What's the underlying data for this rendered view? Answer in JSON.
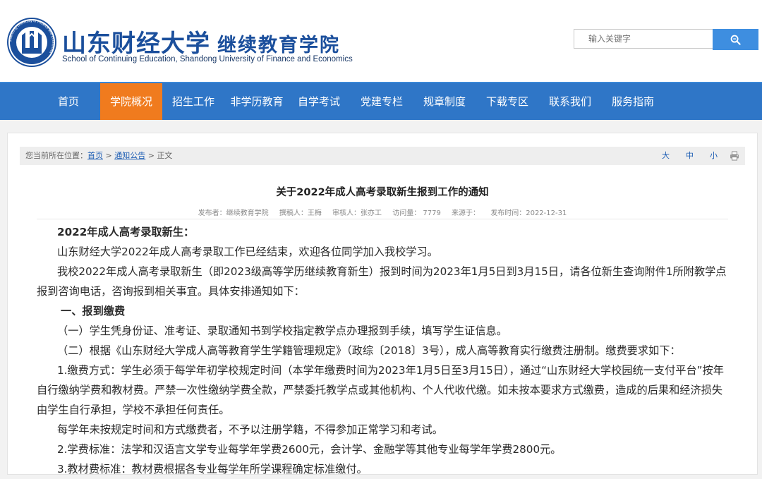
{
  "header": {
    "title_cn": "山东财经大学",
    "title_cn_sub": "继续教育学院",
    "title_en": "School of Continuing Education, Shandong University of Finance and Economics",
    "logo_ring_text": "Shandong University of Finance and Economics",
    "search_placeholder": "输入关键字",
    "search_icon": "search-icon"
  },
  "nav": {
    "items": [
      "首页",
      "学院概况",
      "招生工作",
      "非学历教育",
      "自学考试",
      "党建专栏",
      "规章制度",
      "下载专区",
      "联系我们",
      "服务指南"
    ],
    "active": "学院概况"
  },
  "breadcrumb": {
    "prefix": "您当前所在位置：",
    "home": "首页",
    "sep": " > ",
    "section": "通知公告",
    "current": "正文",
    "font_large": "大",
    "font_medium": "中",
    "font_small": "小",
    "print_icon": "printer-icon"
  },
  "article": {
    "title": "关于2022年成人高考录取新生报到工作的通知",
    "meta": {
      "publisher": "发布者：继续教育学院",
      "author": "撰稿人：王梅",
      "reviewer": "审核人：张亦工",
      "views": "访问量： 7779",
      "source": "来源于：",
      "date": "发布时间：2022-12-31"
    },
    "paragraphs": [
      "2022年成人高考录取新生：",
      "山东财经大学2022年成人高考录取工作已经结束，欢迎各位同学加入我校学习。",
      "我校2022年成人高考录取新生（即2023级高等学历继续教育新生）报到时间为2023年1月5日到3月15日，请各位新生查询附件1所附教学点报到咨询电话，咨询报到相关事宜。具体安排通知如下：",
      "一、报到缴费",
      "（一）学生凭身份证、准考证、录取通知书到学校指定教学点办理报到手续，填写学生证信息。",
      "（二）根据《山东财经大学成人高等教育学生学籍管理规定》（政综〔2018〕3号），成人高等教育实行缴费注册制。缴费要求如下：",
      "1.缴费方式：学生必须于每学年初学校规定时间（本学年缴费时间为2023年1月5日至3月15日），通过“山东财经大学校园统一支付平台”按年自行缴纳学费和教材费。严禁一次性缴纳学费全款，严禁委托教学点或其他机构、个人代收代缴。如未按本要求方式缴费，造成的后果和经济损失由学生自行承担，学校不承担任何责任。",
      "每学年未按规定时间和方式缴费者，不予以注册学籍，不得参加正常学习和考试。",
      "2.学费标准：法学和汉语言文学专业每学年学费2600元，会计学、金融学等其他专业每学年学费2800元。",
      "3.教材费标准：教材费根据各专业每学年所学课程确定标准缴付。"
    ]
  },
  "colors": {
    "nav_bg": "#2f76c7",
    "nav_active": "#f07b1e",
    "brand_blue": "#1b4f9c",
    "search_button": "#3e8ee0",
    "link": "#1e5eb4"
  }
}
